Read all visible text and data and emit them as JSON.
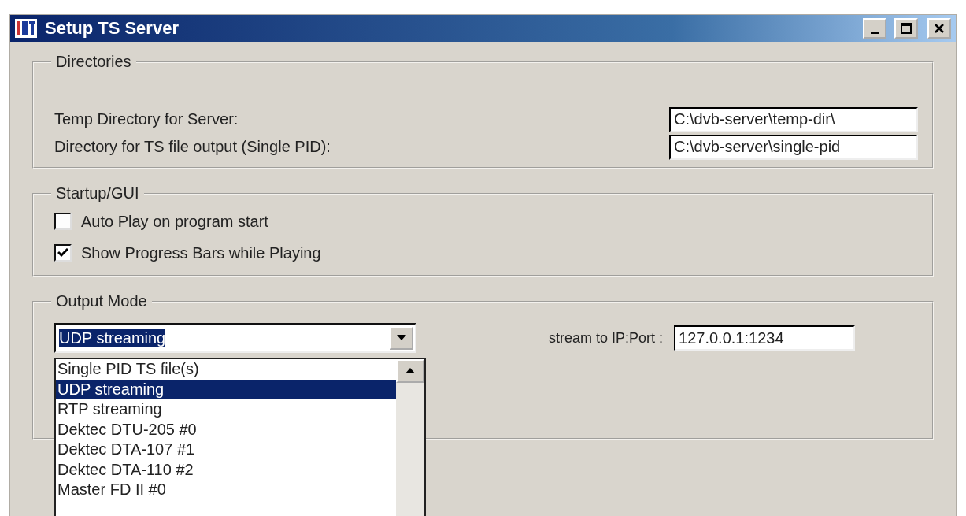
{
  "window": {
    "title": "Setup TS Server"
  },
  "directories": {
    "title": "Directories",
    "fields": [
      {
        "label": "Temp Directory for Server:",
        "value": "C:\\dvb-server\\temp-dir\\"
      },
      {
        "label": "Directory for TS file output (Single PID):",
        "value": "C:\\dvb-server\\single-pid"
      }
    ]
  },
  "startup": {
    "title": "Startup/GUI",
    "options": [
      {
        "label": "Auto Play on program start",
        "checked": false
      },
      {
        "label": "Show Progress Bars while Playing",
        "checked": true
      }
    ]
  },
  "output_mode": {
    "title": "Output Mode",
    "combo": {
      "value": "UDP streaming",
      "expanded": true
    },
    "options": [
      {
        "label": "Single PID TS file(s)",
        "selected": false
      },
      {
        "label": "UDP streaming",
        "selected": true
      },
      {
        "label": "RTP streaming",
        "selected": false
      },
      {
        "label": "Dektec DTU-205 #0",
        "selected": false
      },
      {
        "label": "Dektec DTA-107 #1",
        "selected": false
      },
      {
        "label": "Dektec DTA-110 #2",
        "selected": false
      },
      {
        "label": "Master FD II #0",
        "selected": false
      }
    ],
    "ip": {
      "label": "stream to IP:Port :",
      "value": "127.0.0.1:1234"
    }
  }
}
